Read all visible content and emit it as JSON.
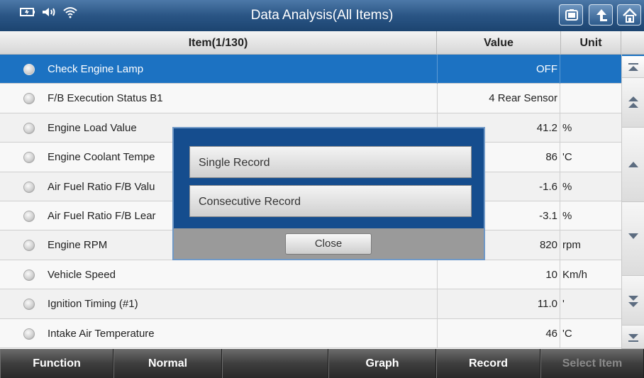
{
  "header": {
    "title": "Data Analysis(All Items)"
  },
  "table": {
    "columns": {
      "item": "Item(1/130)",
      "value": "Value",
      "unit": "Unit"
    },
    "rows": [
      {
        "name": "Check Engine Lamp",
        "value": "OFF",
        "unit": ""
      },
      {
        "name": "F/B Execution Status B1",
        "value": "4 Rear Sensor",
        "unit": ""
      },
      {
        "name": "Engine Load Value",
        "value": "41.2",
        "unit": "%"
      },
      {
        "name": "Engine Coolant Tempe",
        "value": "86",
        "unit": "'C"
      },
      {
        "name": "Air Fuel Ratio F/B Valu",
        "value": "-1.6",
        "unit": "%"
      },
      {
        "name": "Air Fuel Ratio F/B Lear",
        "value": "-3.1",
        "unit": "%"
      },
      {
        "name": "Engine RPM",
        "value": "820",
        "unit": "rpm"
      },
      {
        "name": "Vehicle Speed",
        "value": "10",
        "unit": "Km/h"
      },
      {
        "name": "Ignition Timing (#1)",
        "value": "11.0",
        "unit": "'"
      },
      {
        "name": "Intake Air Temperature",
        "value": "46",
        "unit": "'C"
      }
    ]
  },
  "dialog": {
    "option1": "Single Record",
    "option2": "Consecutive Record",
    "close": "Close"
  },
  "toolbar": {
    "function": "Function",
    "normal": "Normal",
    "graph": "Graph",
    "record": "Record",
    "select_item": "Select Item"
  },
  "colors": {
    "accent": "#1c72c2",
    "dialog_bg": "#154d8e"
  }
}
